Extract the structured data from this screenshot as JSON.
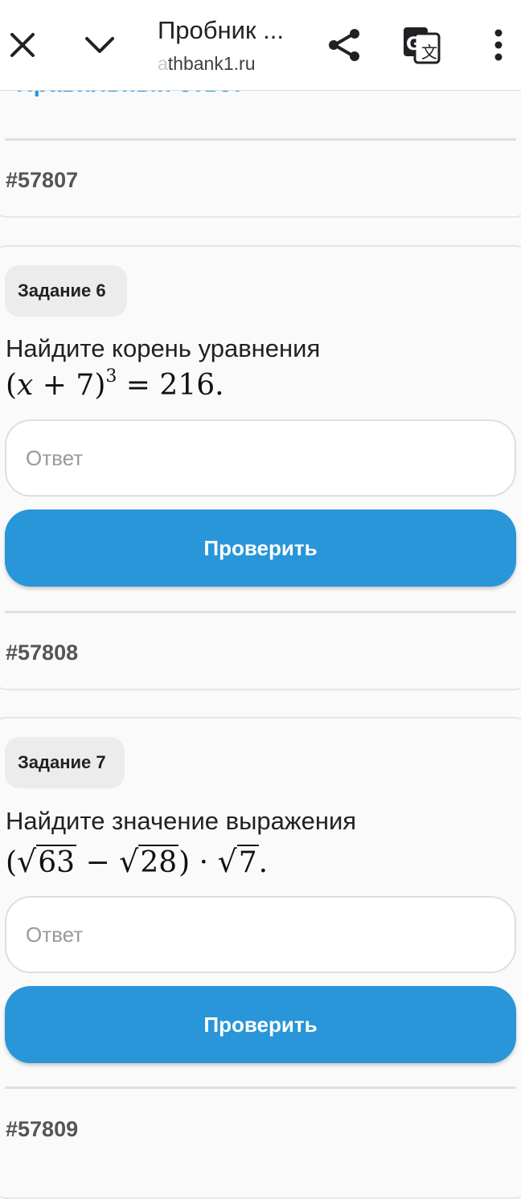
{
  "toolbar": {
    "title": "Пробник ...",
    "url_faded": "a",
    "url": "thbank1.ru"
  },
  "previous": {
    "cutoff_link": "Правильный ответ",
    "task_id": "#57807"
  },
  "tasks": [
    {
      "badge": "Задание 6",
      "question": "Найдите корень уравнения",
      "formula": "(x + 7)^3 = 216.",
      "answer_placeholder": "Ответ",
      "check_label": "Проверить",
      "task_id": "#57808"
    },
    {
      "badge": "Задание 7",
      "question": "Найдите значение выражения",
      "formula": "(√63 − √28) · √7.",
      "answer_placeholder": "Ответ",
      "check_label": "Проверить",
      "task_id": "#57809"
    }
  ],
  "colors": {
    "accent": "#2896d8",
    "link": "#2b96d8",
    "background": "#fafafa"
  },
  "icons": [
    "close-icon",
    "chevron-down-icon",
    "share-icon",
    "translate-icon",
    "more-vert-icon"
  ]
}
